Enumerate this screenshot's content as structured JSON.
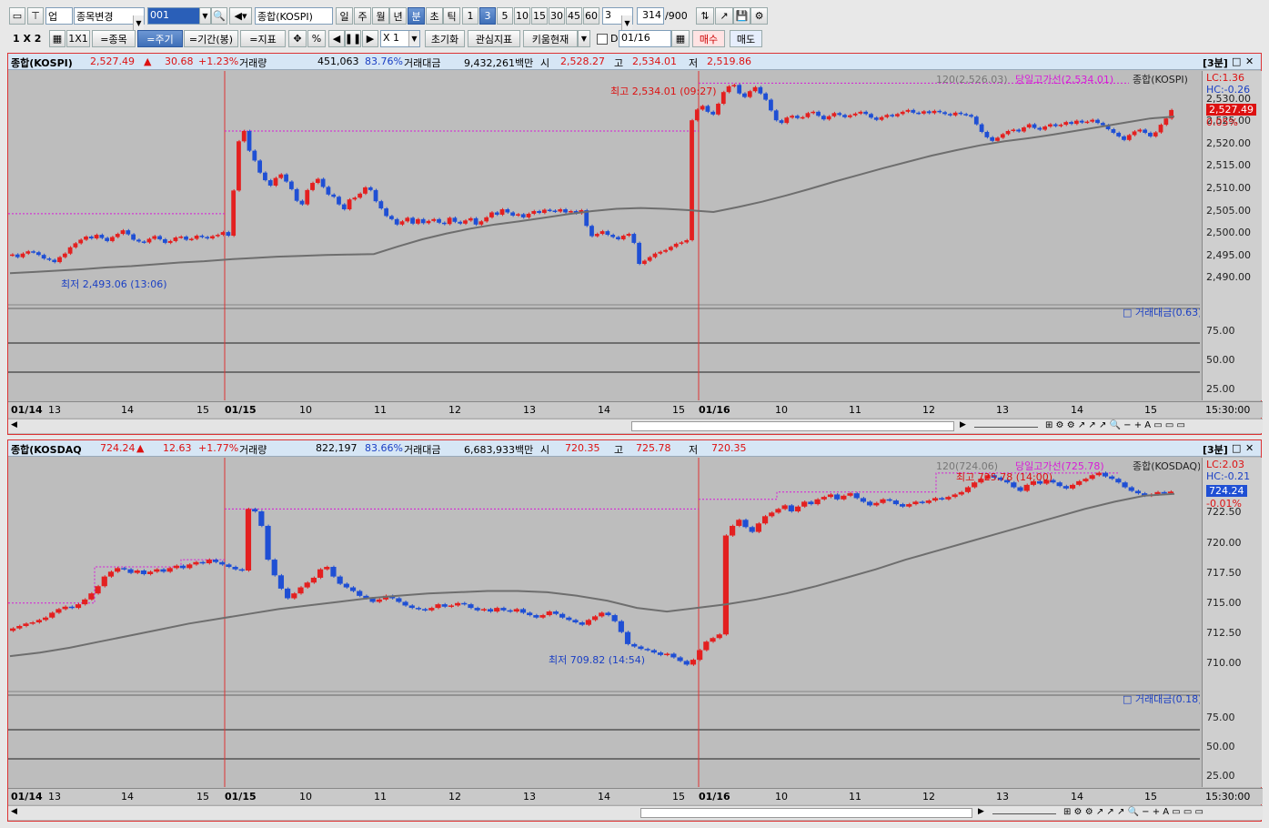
{
  "toolbar1": {
    "market": "업",
    "stock_change": "종목변경",
    "code": "001",
    "index_name": "종합(KOSPI)",
    "periods": [
      "일",
      "주",
      "월",
      "년",
      "분",
      "초",
      "틱"
    ],
    "minutes": [
      "1",
      "3",
      "5",
      "10",
      "15",
      "30",
      "45",
      "60"
    ],
    "step": "3",
    "count": "314",
    "total": "/900"
  },
  "toolbar2": {
    "layout": "1 X 2",
    "grid": "1X1",
    "btn_stock": "=종목",
    "btn_period": "=주기",
    "btn_range": "=기간(봉)",
    "btn_indicator": "=지표",
    "pct": "%",
    "zoom": "X 1",
    "init": "초기화",
    "interest": "관심지표",
    "kiwoom": "키움현재",
    "date_check": "D",
    "date": "01/16",
    "buy": "매수",
    "sell": "매도"
  },
  "kospi": {
    "name": "종합(KOSPI)",
    "price": "2,527.49",
    "arrow": "▲",
    "change": "30.68",
    "rate": "+1.23%",
    "vol_label": "거래량",
    "volume": "451,063",
    "vol_rate": "83.76%",
    "amt_label": "거래대금",
    "amount": "9,432,261백만",
    "open_label": "시",
    "open": "2,528.27",
    "high_label": "고",
    "high": "2,534.01",
    "low_label": "저",
    "low": "2,519.86",
    "period": "[3분]",
    "ma_label": "120(2,526.03)",
    "line_label": "당일고가선(2,534.01)",
    "series_label": "종합(KOSPI)",
    "hi_note": "최고 2,534.01 (09:27)",
    "lo_note": "최저 2,493.06 (13:06)",
    "lc": "LC:1.36",
    "hc": "HC:-0.26",
    "price_tag": "2,527.49",
    "pct_tag": "0.05%",
    "y_ticks": [
      "2,530.00",
      "2,525.00",
      "2,520.00",
      "2,515.00",
      "2,510.00",
      "2,505.00",
      "2,500.00",
      "2,495.00",
      "2,490.00"
    ],
    "sub_label": "거래대금(0.63)",
    "sub_ticks": [
      "75.00",
      "50.00",
      "25.00"
    ],
    "end_time": "15:30:00"
  },
  "kosdaq": {
    "name": "종합(KOSDAQ",
    "price": "724.24",
    "arrow": "▲",
    "change": "12.63",
    "rate": "+1.77%",
    "vol_label": "거래량",
    "volume": "822,197",
    "vol_rate": "83.66%",
    "amt_label": "거래대금",
    "amount": "6,683,933백만",
    "open_label": "시",
    "open": "720.35",
    "high_label": "고",
    "high": "725.78",
    "low_label": "저",
    "low": "720.35",
    "period": "[3분]",
    "ma_label": "120(724.06)",
    "line_label": "당일고가선(725.78)",
    "series_label": "종합(KOSDAQ)",
    "hi_note": "최고 725.78 (14:00)",
    "lo_note": "최저 709.82 (14:54)",
    "lc": "LC:2.03",
    "hc": "HC:-0.21",
    "price_tag": "724.24",
    "pct_tag": "-0.01%",
    "y_ticks": [
      "722.50",
      "720.00",
      "717.50",
      "715.00",
      "712.50",
      "710.00"
    ],
    "sub_label": "거래대금(0.18)",
    "sub_ticks": [
      "75.00",
      "50.00",
      "25.00"
    ],
    "end_time": "15:30:00"
  },
  "time_axis": [
    "01/14",
    "13",
    "14",
    "15",
    "01/15",
    "10",
    "11",
    "12",
    "13",
    "14",
    "15",
    "01/16",
    "10",
    "11",
    "12",
    "13",
    "14",
    "15"
  ],
  "colors": {
    "up": "#e32020",
    "down": "#1f4fd4",
    "ma": "#6e6e6e",
    "high_line": "#d81ad8",
    "bg": "#bdbdbd"
  },
  "chart_data": [
    {
      "type": "candlestick",
      "title": "종합(KOSPI) 3분",
      "ylim": [
        2487,
        2535
      ],
      "ma": "120",
      "close": [
        2495.2,
        2494.6,
        2495.4,
        2495.9,
        2495.7,
        2495.1,
        2494.3,
        2494.0,
        2493.5,
        2494.6,
        2495.4,
        2496.8,
        2497.7,
        2498.5,
        2499.2,
        2498.8,
        2499.6,
        2498.9,
        2498.2,
        2499.1,
        2499.8,
        2500.6,
        2499.7,
        2498.5,
        2498.1,
        2497.9,
        2498.7,
        2499.3,
        2498.6,
        2497.8,
        2498.2,
        2499.0,
        2499.2,
        2498.5,
        2498.7,
        2499.4,
        2499.1,
        2498.8,
        2499.3,
        2499.6,
        2500.2,
        2499.4,
        2509.5,
        2520.5,
        2522.8,
        2518.4,
        2516.2,
        2513.5,
        2511.8,
        2510.6,
        2512.3,
        2513.1,
        2511.5,
        2509.8,
        2507.2,
        2506.4,
        2509.6,
        2511.2,
        2512.1,
        2510.3,
        2508.6,
        2508.1,
        2506.4,
        2505.3,
        2507.5,
        2507.9,
        2508.8,
        2510.2,
        2509.6,
        2507.1,
        2505.5,
        2503.8,
        2503.1,
        2501.9,
        2502.6,
        2503.4,
        2502.1,
        2503.1,
        2502.2,
        2502.7,
        2503.1,
        2502.3,
        2502.0,
        2503.4,
        2502.5,
        2502.1,
        2502.8,
        2503.3,
        2501.9,
        2502.6,
        2503.5,
        2504.6,
        2504.1,
        2505.3,
        2504.6,
        2503.9,
        2504.2,
        2503.5,
        2504.3,
        2504.9,
        2504.5,
        2505.2,
        2505.0,
        2504.8,
        2505.3,
        2504.6,
        2504.9,
        2504.4,
        2505.1,
        2501.6,
        2499.3,
        2499.8,
        2500.4,
        2499.6,
        2499.1,
        2498.6,
        2499.4,
        2499.8,
        2497.8,
        2493.1,
        2493.8,
        2494.6,
        2495.4,
        2495.8,
        2496.2,
        2496.9,
        2497.6,
        2497.9,
        2498.4,
        2525.2,
        2527.6,
        2528.4,
        2527.1,
        2526.5,
        2528.9,
        2531.5,
        2532.8,
        2533.1,
        2531.2,
        2530.4,
        2531.7,
        2532.6,
        2531.2,
        2529.8,
        2527.4,
        2525.2,
        2524.6,
        2525.8,
        2526.2,
        2525.7,
        2525.9,
        2526.8,
        2527.1,
        2526.2,
        2525.4,
        2526.1,
        2526.8,
        2526.4,
        2525.9,
        2526.3,
        2526.7,
        2527.1,
        2526.6,
        2525.8,
        2525.3,
        2525.9,
        2526.4,
        2526.1,
        2526.6,
        2527.1,
        2527.5,
        2526.9,
        2526.7,
        2527.2,
        2526.8,
        2527.3,
        2527.0,
        2526.6,
        2526.3,
        2526.9,
        2526.6,
        2526.4,
        2526.0,
        2524.3,
        2522.6,
        2521.4,
        2520.6,
        2521.3,
        2522.1,
        2522.8,
        2523.1,
        2522.7,
        2523.6,
        2524.3,
        2523.5,
        2523.1,
        2523.8,
        2524.3,
        2523.9,
        2524.2,
        2524.8,
        2524.4,
        2525.1,
        2524.7,
        2524.9,
        2525.3,
        2524.6,
        2524.1,
        2523.2,
        2522.4,
        2521.6,
        2520.8,
        2521.9,
        2522.7,
        2523.1,
        2522.4,
        2521.6,
        2522.5,
        2524.2,
        2525.6,
        2527.49
      ],
      "ma_values": [
        2491.0,
        2491.3,
        2491.6,
        2491.9,
        2492.3,
        2492.6,
        2493.0,
        2493.4,
        2493.7,
        2494.1,
        2494.4,
        2494.7,
        2494.9,
        2495.1,
        2495.2,
        2495.3,
        2497.0,
        2498.6,
        2499.9,
        2501.0,
        2501.9,
        2502.6,
        2503.4,
        2504.2,
        2504.9,
        2505.4,
        2505.6,
        2505.4,
        2505.1,
        2504.7,
        2505.8,
        2507.0,
        2508.4,
        2509.9,
        2511.5,
        2513.0,
        2514.5,
        2515.9,
        2517.3,
        2518.5,
        2519.6,
        2520.5,
        2521.2,
        2522.0,
        2522.9,
        2523.8,
        2524.7,
        2525.6,
        2526.03
      ]
    },
    {
      "type": "candlestick",
      "title": "종합(KOSDAQ) 3분",
      "ylim": [
        708.8,
        726.6
      ],
      "ma": "120",
      "close": [
        712.9,
        713.1,
        713.3,
        713.4,
        713.6,
        713.8,
        714.2,
        714.5,
        714.7,
        714.6,
        714.9,
        715.3,
        715.8,
        716.4,
        717.2,
        717.6,
        717.9,
        717.8,
        717.5,
        717.7,
        717.4,
        717.6,
        717.8,
        717.6,
        717.9,
        718.1,
        717.9,
        718.2,
        718.4,
        718.3,
        718.6,
        718.4,
        718.2,
        718.0,
        717.8,
        717.7,
        722.8,
        722.6,
        721.4,
        718.6,
        717.3,
        716.2,
        715.4,
        715.8,
        716.3,
        716.7,
        717.1,
        717.8,
        718.0,
        717.2,
        716.6,
        716.3,
        716.0,
        715.6,
        715.4,
        715.1,
        715.3,
        715.6,
        715.4,
        715.1,
        714.8,
        714.6,
        714.5,
        714.4,
        714.6,
        714.9,
        714.7,
        714.8,
        715.0,
        714.9,
        714.6,
        714.4,
        714.5,
        714.3,
        714.6,
        714.4,
        714.3,
        714.5,
        714.2,
        714.0,
        713.8,
        714.0,
        714.3,
        714.1,
        713.8,
        713.6,
        713.4,
        713.2,
        713.6,
        713.9,
        714.2,
        714.0,
        713.5,
        712.6,
        711.6,
        711.4,
        711.2,
        711.1,
        710.9,
        710.7,
        710.8,
        710.5,
        710.2,
        709.9,
        710.3,
        711.1,
        711.8,
        712.1,
        712.4,
        720.6,
        721.4,
        721.9,
        721.3,
        720.9,
        721.6,
        722.2,
        722.5,
        722.8,
        723.1,
        722.6,
        723.0,
        723.4,
        723.2,
        723.6,
        723.8,
        724.0,
        723.6,
        723.9,
        724.1,
        723.7,
        723.4,
        723.1,
        723.3,
        723.6,
        723.5,
        723.2,
        723.0,
        723.2,
        723.4,
        723.3,
        723.5,
        723.7,
        723.6,
        723.8,
        724.0,
        724.2,
        724.6,
        725.0,
        725.3,
        725.6,
        725.4,
        725.2,
        725.0,
        724.6,
        724.3,
        724.8,
        725.1,
        724.9,
        725.2,
        725.0,
        724.7,
        724.5,
        724.8,
        725.1,
        725.3,
        725.6,
        725.8,
        725.5,
        725.3,
        725.0,
        724.6,
        724.3,
        724.1,
        723.9,
        724.0,
        724.2,
        724.1,
        724.24
      ],
      "ma_values": [
        710.6,
        710.9,
        711.3,
        711.8,
        712.3,
        712.8,
        713.3,
        713.7,
        714.1,
        714.5,
        714.8,
        715.1,
        715.4,
        715.6,
        715.8,
        715.9,
        716.0,
        716.0,
        715.9,
        715.6,
        715.2,
        714.6,
        714.3,
        714.6,
        714.9,
        715.3,
        715.8,
        716.4,
        717.1,
        717.8,
        718.6,
        719.3,
        720.0,
        720.7,
        721.4,
        722.1,
        722.8,
        723.4,
        723.9,
        724.06
      ]
    }
  ]
}
